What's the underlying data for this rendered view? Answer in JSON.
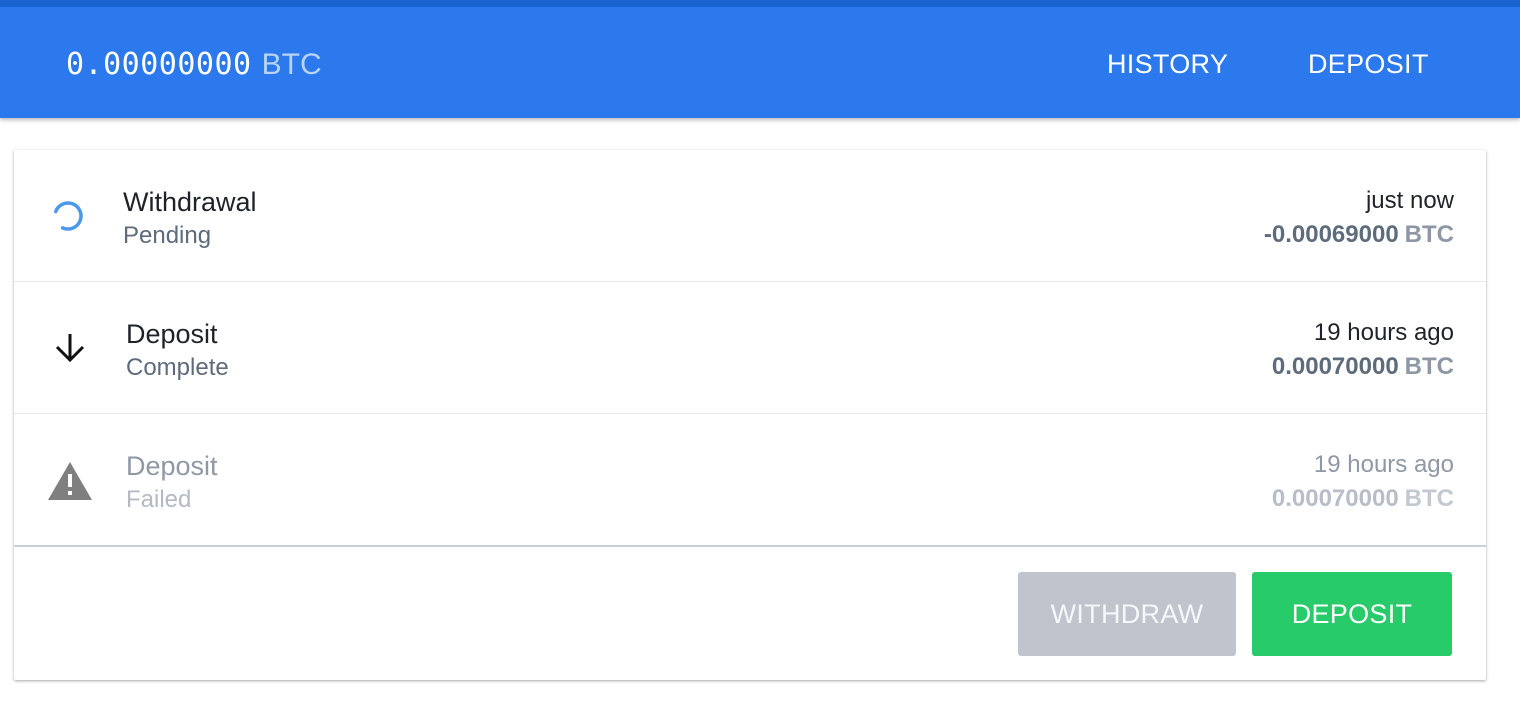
{
  "header": {
    "balance_amount": "0.00000000",
    "balance_unit": "BTC",
    "nav": {
      "history_label": "HISTORY",
      "deposit_label": "DEPOSIT"
    }
  },
  "transactions": [
    {
      "type": "Withdrawal",
      "status": "Pending",
      "time": "just now",
      "amount": "-0.00069000",
      "unit": "BTC",
      "icon": "spinner-icon"
    },
    {
      "type": "Deposit",
      "status": "Complete",
      "time": "19 hours ago",
      "amount": "0.00070000",
      "unit": "BTC",
      "icon": "arrow-down-icon"
    },
    {
      "type": "Deposit",
      "status": "Failed",
      "time": "19 hours ago",
      "amount": "0.00070000",
      "unit": "BTC",
      "icon": "warning-icon"
    }
  ],
  "actions": {
    "withdraw_label": "WITHDRAW",
    "deposit_label": "DEPOSIT"
  },
  "colors": {
    "header_bg": "#2b79ec",
    "spinner": "#4a98ee",
    "withdraw_disabled": "#c0c5cd",
    "deposit_green": "#27cb69"
  }
}
